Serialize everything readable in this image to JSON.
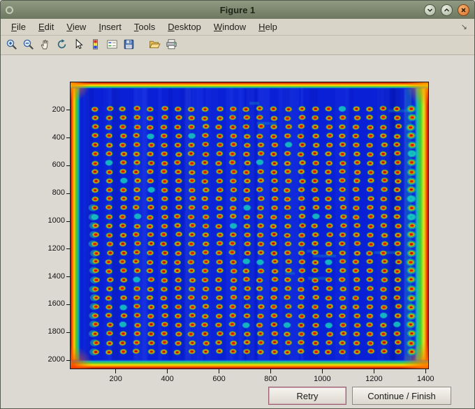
{
  "window": {
    "title": "Figure 1",
    "controls": [
      {
        "id": "minimize",
        "icon": "chevron-down"
      },
      {
        "id": "maximize",
        "icon": "chevron-up"
      },
      {
        "id": "close",
        "icon": "cross"
      }
    ]
  },
  "menu": {
    "items": [
      "File",
      "Edit",
      "View",
      "Insert",
      "Tools",
      "Desktop",
      "Window",
      "Help"
    ],
    "collapse_glyph": "↘"
  },
  "toolbar": {
    "buttons": [
      "zoom-in",
      "zoom-out",
      "pan",
      "rotate-3d",
      "data-cursor",
      "colorbar",
      "insert-legend",
      "save",
      "separator",
      "open",
      "print"
    ]
  },
  "plot": {
    "type": "heatmap-image",
    "colormap": "jet",
    "x_ticks": [
      200,
      400,
      600,
      800,
      1000,
      1200,
      1400
    ],
    "y_ticks": [
      200,
      400,
      600,
      800,
      1000,
      1200,
      1400,
      1600,
      1800,
      2000
    ],
    "x_range": [
      25,
      1410
    ],
    "y_range": [
      0,
      2060
    ],
    "grid": {
      "rows": 28,
      "cols": 24
    },
    "colors": {
      "base": "#0a20d6",
      "spot_core": "#9c0000",
      "spot_ring": "#e82800",
      "ring_yellow": "#efdf10",
      "ring_green": "#2ebe28",
      "edge_red": "#c00000",
      "edge_orange": "#ff6a00",
      "edge_yellow": "#ffd200",
      "edge_green": "#3ccf32",
      "edge_cyan": "#14b4c8"
    }
  },
  "buttons": {
    "retry": "Retry",
    "continue": "Continue / Finish"
  }
}
